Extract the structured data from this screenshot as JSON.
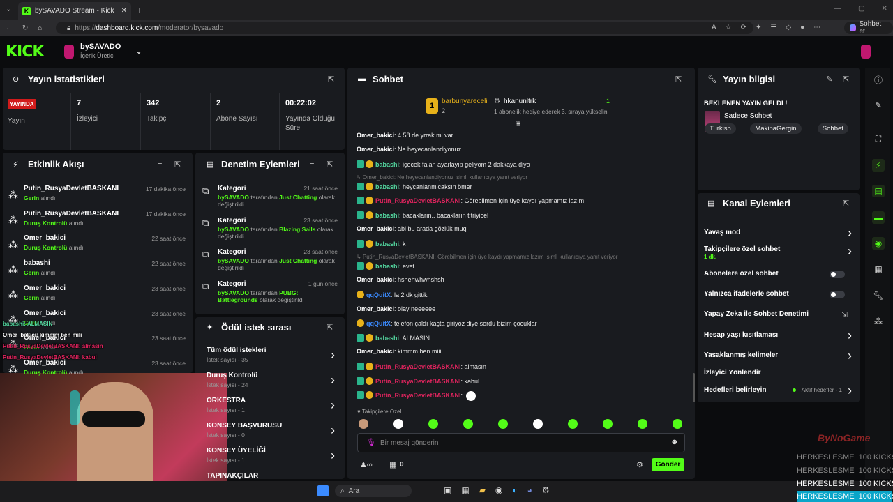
{
  "browser": {
    "tab_title": "bySAVADO Stream - Kick Dashboa",
    "url_prefix": "https://",
    "url_host": "dashboard.kick.com",
    "url_path": "/moderator/bysavado",
    "profile_btn": "Sohbet et"
  },
  "header": {
    "logo": "KICK",
    "channel": "bySAVADO",
    "role": "İçerik Üretici"
  },
  "stats": {
    "title": "Yayın İstatistikleri",
    "live_badge": "YAYINDA",
    "live_label": "Yayın",
    "items": [
      {
        "value": "7",
        "label": "İzleyici"
      },
      {
        "value": "342",
        "label": "Takipçi"
      },
      {
        "value": "2",
        "label": "Abone Sayısı"
      },
      {
        "value": "00:22:02",
        "label": "Yayında Olduğu Süre"
      }
    ]
  },
  "activity": {
    "title": "Etkinlik Akışı",
    "items": [
      {
        "user": "Putin_RusyaDevletBASKANI",
        "action": "Gerin",
        "suffix": "alındı",
        "time": "17 dakika önce"
      },
      {
        "user": "Putin_RusyaDevletBASKANI",
        "action": "Duruş Kontrolü",
        "suffix": "alındı",
        "time": "17 dakika önce"
      },
      {
        "user": "Omer_bakici",
        "action": "Duruş Kontrolü",
        "suffix": "alındı",
        "time": "22 saat önce"
      },
      {
        "user": "babashi",
        "action": "Gerin",
        "suffix": "alındı",
        "time": "22 saat önce"
      },
      {
        "user": "Omer_bakici",
        "action": "Gerin",
        "suffix": "alındı",
        "time": "23 saat önce"
      },
      {
        "user": "Omer_bakici",
        "action": "Gerin",
        "suffix": "alındı",
        "time": "23 saat önce"
      },
      {
        "user": "Omer_bakici",
        "action": "Gerin",
        "suffix": "alındı",
        "time": "23 saat önce"
      },
      {
        "user": "Omer_bakici",
        "action": "Duruş Kontrolü",
        "suffix": "alındı",
        "time": "23 saat önce"
      }
    ]
  },
  "moderation": {
    "title": "Denetim Eylemleri",
    "items": [
      {
        "title": "Kategori",
        "time": "21 saat önce",
        "by": "bySAVADO",
        "mid": "tarafından",
        "cat": "Just Chatting",
        "rest": "olarak değiştirildi"
      },
      {
        "title": "Kategori",
        "time": "23 saat önce",
        "by": "bySAVADO",
        "mid": "tarafından",
        "cat": "Blazing Sails",
        "rest": "olarak değiştirildi"
      },
      {
        "title": "Kategori",
        "time": "23 saat önce",
        "by": "bySAVADO",
        "mid": "tarafından",
        "cat": "Just Chatting",
        "rest": "olarak değiştirildi"
      },
      {
        "title": "Kategori",
        "time": "1 gün önce",
        "by": "bySAVADO",
        "mid": "tarafından",
        "cat": "PUBG: Battlegrounds",
        "rest": "olarak değiştirildi"
      }
    ]
  },
  "rewards": {
    "title": "Ödül istek sırası",
    "items": [
      {
        "name": "Tüm ödül istekleri",
        "count": "İstek sayısı - 35"
      },
      {
        "name": "Duruş Kontrolü",
        "count": "İstek sayısı - 24"
      },
      {
        "name": "ORKESTRA",
        "count": "İstek sayısı - 1"
      },
      {
        "name": "KONSEY BAŞVURUSU",
        "count": "İstek sayısı - 0"
      },
      {
        "name": "KONSEY ÜYELİĞİ",
        "count": "İstek sayısı - 1"
      },
      {
        "name": "TAPINAKÇILAR",
        "count": ""
      }
    ]
  },
  "chat": {
    "title": "Sohbet",
    "pinned": {
      "user1": "barbunyareceli",
      "num1": "2",
      "user2": "hkanunltrk",
      "num2": "1",
      "msg": "1 abonelik hediye ederek 3. sıraya yükselin"
    },
    "lines": [
      {
        "user": "Omer_bakici",
        "color": "#ffffff",
        "badges": "",
        "text": "4.58 de yrrak mi var"
      },
      {
        "user": "Omer_bakici",
        "color": "#ffffff",
        "badges": "",
        "text": "Ne heyecanlandiyonuz"
      },
      {
        "user": "babashi",
        "color": "#53d8a0",
        "badges": "gy",
        "text": "içecek falan ayarlayıp geliyom 2 dakkaya diyo"
      },
      {
        "user": "",
        "color": "#888",
        "badges": "",
        "text": "↳ Omer_bakici: Ne heyecanlandiyonuz isimli kullanıcıya yanıt veriyor",
        "reply": true
      },
      {
        "user": "babashi",
        "color": "#53d8a0",
        "badges": "gy",
        "text": "heycanlanmicaksın ömer"
      },
      {
        "user": "Putin_RusyaDevletBASKANI",
        "color": "#e0245e",
        "badges": "gy",
        "text": "Görebilmen için üye kaydı yapmamız lazım"
      },
      {
        "user": "babashi",
        "color": "#53d8a0",
        "badges": "gy",
        "text": "bacakların.. bacakların titriyicel"
      },
      {
        "user": "Omer_bakici",
        "color": "#ffffff",
        "badges": "",
        "text": "abi bu arada gözlük muq"
      },
      {
        "user": "babashi",
        "color": "#53d8a0",
        "badges": "gy",
        "text": "k"
      },
      {
        "user": "",
        "color": "#888",
        "badges": "",
        "text": "↳ Putin_RusyaDevletBASKANI: Görebilmen için üye kaydı yapmamız lazım isimli kullanıcıya yanıt veriyor",
        "reply": true
      },
      {
        "user": "babashi",
        "color": "#53d8a0",
        "badges": "gy",
        "text": "evet"
      },
      {
        "user": "Omer_bakici",
        "color": "#ffffff",
        "badges": "",
        "text": "hshehwhwhshsh"
      },
      {
        "user": "qqQuitX",
        "color": "#3b8bff",
        "badges": "y",
        "text": "la 2 dk gittik"
      },
      {
        "user": "Omer_bakici",
        "color": "#ffffff",
        "badges": "",
        "text": "olay neeeeee"
      },
      {
        "user": "qqQuitX",
        "color": "#3b8bff",
        "badges": "y",
        "text": "telefon çaldı kaçta giriyoz diye sordu bizim çocuklar"
      },
      {
        "user": "babashi",
        "color": "#53d8a0",
        "badges": "gy",
        "text": "ALMASIN"
      },
      {
        "user": "Omer_bakici",
        "color": "#ffffff",
        "badges": "",
        "text": "kimmm ben miii"
      },
      {
        "user": "Putin_RusyaDevletBASKANI",
        "color": "#e0245e",
        "badges": "gy",
        "text": "almasın"
      },
      {
        "user": "Putin_RusyaDevletBASKANI",
        "color": "#e0245e",
        "badges": "gy",
        "text": "kabul"
      },
      {
        "user": "Putin_RusyaDevletBASKANI",
        "color": "#e0245e",
        "badges": "gy",
        "text": ""
      }
    ],
    "followers_only": "Takipçilere Özel",
    "placeholder": "Bir mesaj gönderin",
    "points": "0",
    "send": "Gönder"
  },
  "info": {
    "title": "Yayın bilgisi",
    "stream_title": "BEKLENEN YAYIN GELDİ !",
    "category": "Sadece Sohbet",
    "tags": [
      "Turkish",
      "MakinaGergin",
      "Sohbet"
    ]
  },
  "channel_actions": {
    "title": "Kanal Eylemleri",
    "items": [
      {
        "label": "Yavaş mod",
        "extra": "",
        "type": "arrow"
      },
      {
        "label": "Takipçilere özel sohbet",
        "extra": "1 dk.",
        "type": "arrow"
      },
      {
        "label": "Abonelere özel sohbet",
        "extra": "",
        "type": "toggle"
      },
      {
        "label": "Yalnızca ifadelerle sohbet",
        "extra": "",
        "type": "toggle"
      },
      {
        "label": "Yapay Zeka ile Sohbet Denetimi",
        "extra": "",
        "type": "ext"
      },
      {
        "label": "Hesap yaşı kısıtlaması",
        "extra": "",
        "type": "arrow"
      },
      {
        "label": "Yasaklanmış kelimeler",
        "extra": "",
        "type": "arrow"
      },
      {
        "label": "İzleyici Yönlendir",
        "extra": "",
        "type": "none"
      },
      {
        "label": "Hedefleri belirleyin",
        "extra": "Aktif hedefler - 1",
        "type": "arrow"
      }
    ]
  },
  "overlay": {
    "watermark": "ByNoGame",
    "lines": [
      "HERKESLESME  100 KICKS",
      "HERKESLESME  100 KICKS",
      "HERKESLESME  100 KICKS",
      "HERKESLESME  100 KICKS"
    ],
    "ov_chat": [
      "babashi: ALMASIN",
      "Omer_bakici: kimmm ben mili",
      "Putin_RusyaDevletBASKANI: almasın",
      "Putin_RusyaDevletBASKANI: kabul"
    ]
  },
  "taskbar": {
    "search": "Ara"
  }
}
